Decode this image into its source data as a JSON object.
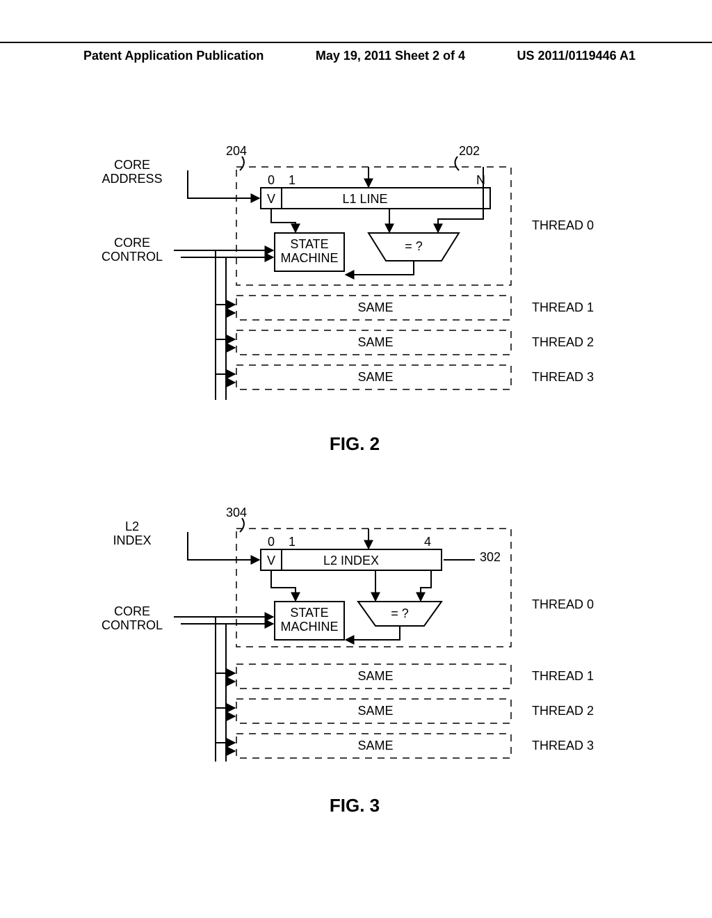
{
  "header": {
    "left": "Patent Application Publication",
    "center": "May 19, 2011  Sheet 2 of 4",
    "right": "US 2011/0119446 A1"
  },
  "fig2": {
    "ref_204": "204",
    "ref_202": "202",
    "core_address": "CORE\nADDRESS",
    "core_control": "CORE\nCONTROL",
    "bits": {
      "b0": "0",
      "b1": "1",
      "bN": "N"
    },
    "v": "V",
    "l1_line": "L1 LINE",
    "state_machine": "STATE\nMACHINE",
    "cmp": "= ?",
    "same": "SAME",
    "threads": {
      "t0": "THREAD 0",
      "t1": "THREAD 1",
      "t2": "THREAD 2",
      "t3": "THREAD 3"
    },
    "caption": "FIG. 2"
  },
  "fig3": {
    "ref_304": "304",
    "ref_302": "302",
    "l2_index_label": "L2\nINDEX",
    "core_control": "CORE\nCONTROL",
    "bits": {
      "b0": "0",
      "b1": "1",
      "b4": "4"
    },
    "v": "V",
    "l2_index": "L2 INDEX",
    "state_machine": "STATE\nMACHINE",
    "cmp": "= ?",
    "same": "SAME",
    "threads": {
      "t0": "THREAD 0",
      "t1": "THREAD 1",
      "t2": "THREAD 2",
      "t3": "THREAD 3"
    },
    "caption": "FIG. 3"
  }
}
